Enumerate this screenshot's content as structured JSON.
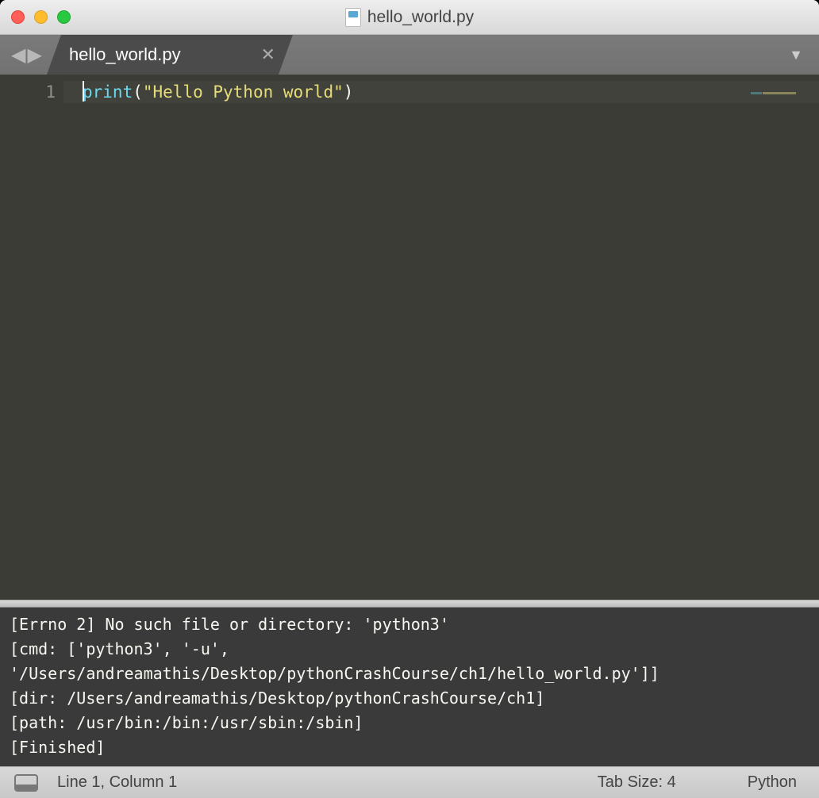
{
  "window": {
    "title": "hello_world.py"
  },
  "tab": {
    "title": "hello_world.py"
  },
  "editor": {
    "line_number": "1",
    "code": {
      "func": "print",
      "open": "(",
      "string": "\"Hello Python world\"",
      "close": ")"
    }
  },
  "output": {
    "lines": [
      "[Errno 2] No such file or directory: 'python3'",
      "[cmd: ['python3', '-u', '/Users/andreamathis/Desktop/pythonCrashCourse/ch1/hello_world.py']]",
      "[dir: /Users/andreamathis/Desktop/pythonCrashCourse/ch1]",
      "[path: /usr/bin:/bin:/usr/sbin:/sbin]",
      "[Finished]"
    ]
  },
  "status": {
    "position": "Line 1, Column 1",
    "tab_size": "Tab Size: 4",
    "language": "Python"
  }
}
